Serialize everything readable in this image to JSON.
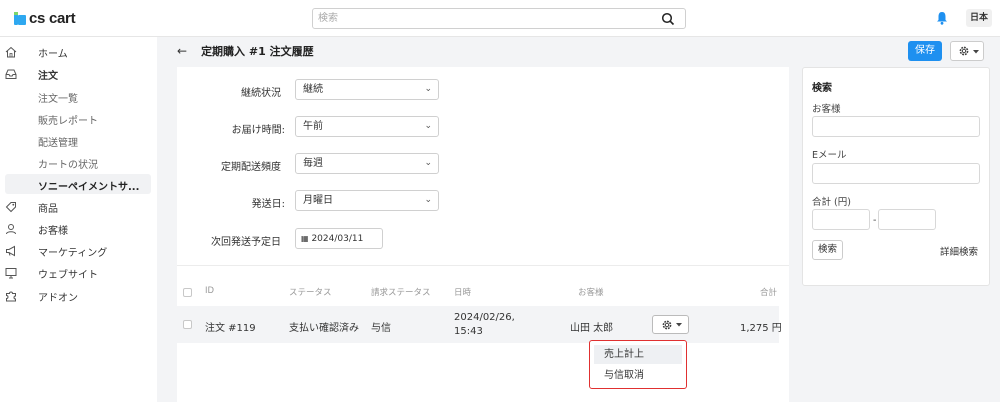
{
  "topbar": {
    "logo_text": "cs cart",
    "search_placeholder": "検索",
    "language": "日本",
    "icons": [
      "search-icon",
      "bell-icon"
    ]
  },
  "sidebar": {
    "items": [
      {
        "label": "ホーム",
        "icon": "home-icon"
      },
      {
        "label": "注文",
        "icon": "inbox-icon"
      },
      {
        "label": "商品",
        "icon": "tag-icon"
      },
      {
        "label": "お客様",
        "icon": "user-icon"
      },
      {
        "label": "マーケティング",
        "icon": "megaphone-icon"
      },
      {
        "label": "ウェブサイト",
        "icon": "monitor-icon"
      },
      {
        "label": "アドオン",
        "icon": "puzzle-icon"
      }
    ],
    "orders_sub": [
      "注文一覧",
      "販売レポート",
      "配送管理",
      "カートの状況",
      "ソニーペイメントサ..."
    ]
  },
  "header": {
    "title": "定期購入 #1 注文履歴",
    "save_label": "保存"
  },
  "form": {
    "fields": [
      {
        "label": "継続状況",
        "value": "継続"
      },
      {
        "label": "お届け時間:",
        "value": "午前"
      },
      {
        "label": "定期配送頻度",
        "value": "毎週"
      },
      {
        "label": "発送日:",
        "value": "月曜日"
      }
    ],
    "next_date_label": "次回発送予定日",
    "next_date_value": "2024/03/11"
  },
  "table": {
    "headers": [
      "ID",
      "ステータス",
      "請求ステータス",
      "日時",
      "お客様",
      "合計"
    ],
    "rows": [
      {
        "id": "注文 #119",
        "status": "支払い確認済み",
        "billing": "与信",
        "date": "2024/02/26,",
        "time": "15:43",
        "customer": "山田 太郎",
        "total": "1,275 円"
      }
    ]
  },
  "dropdown": {
    "items": [
      "売上計上",
      "与信取消"
    ]
  },
  "search_panel": {
    "title": "検索",
    "customer_label": "お客様",
    "email_label": "Eメール",
    "total_label": "合計 (円)",
    "range_sep": "-",
    "search_btn": "検索",
    "advanced_link": "詳細検索"
  },
  "colors": {
    "accent": "#1e90f0",
    "highlight_border": "#e03030",
    "main_bg": "#f3f4f6"
  }
}
